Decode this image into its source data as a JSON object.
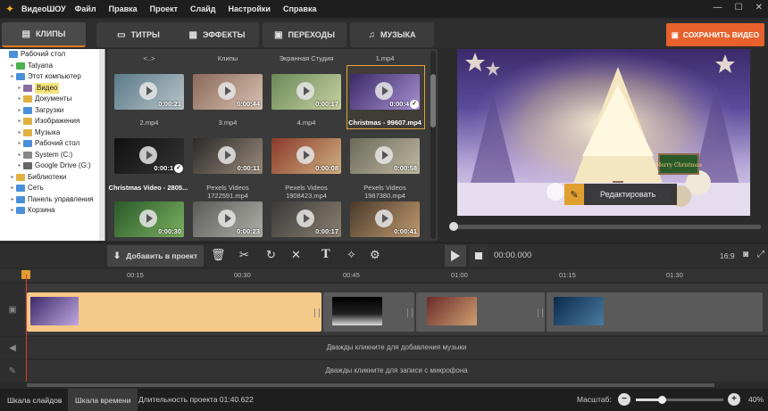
{
  "app": {
    "title": "ВидеоШОУ"
  },
  "menu": [
    "Файл",
    "Правка",
    "Проект",
    "Слайд",
    "Настройки",
    "Справка"
  ],
  "tabs": [
    {
      "label": "КЛИПЫ",
      "icon": "film-icon"
    },
    {
      "label": "ТИТРЫ",
      "icon": "text-icon"
    },
    {
      "label": "ЭФФЕКТЫ",
      "icon": "effects-icon"
    },
    {
      "label": "ПЕРЕХОДЫ",
      "icon": "transition-icon"
    },
    {
      "label": "МУЗЫКА",
      "icon": "music-icon"
    }
  ],
  "save_button": "СОХРАНИТЬ ВИДЕО",
  "tree": [
    {
      "label": "Рабочий стол",
      "indent": 0,
      "color": "#4a90d9"
    },
    {
      "label": "Tatyana",
      "indent": 1,
      "color": "#4caf50"
    },
    {
      "label": "Этот компьютер",
      "indent": 1,
      "color": "#4a90d9"
    },
    {
      "label": "Видео",
      "indent": 2,
      "color": "#8a6aa0",
      "selected": true
    },
    {
      "label": "Документы",
      "indent": 2,
      "color": "#e0b040"
    },
    {
      "label": "Загрузки",
      "indent": 2,
      "color": "#4a90d9"
    },
    {
      "label": "Изображения",
      "indent": 2,
      "color": "#e0b040"
    },
    {
      "label": "Музыка",
      "indent": 2,
      "color": "#e0b040"
    },
    {
      "label": "Рабочий стол",
      "indent": 2,
      "color": "#4a90d9"
    },
    {
      "label": "System (C:)",
      "indent": 2,
      "color": "#888888"
    },
    {
      "label": "Google Drive (G:)",
      "indent": 2,
      "color": "#666666"
    },
    {
      "label": "Библиотеки",
      "indent": 1,
      "color": "#e0b040"
    },
    {
      "label": "Сеть",
      "indent": 1,
      "color": "#4a90d9"
    },
    {
      "label": "Панель управления",
      "indent": 1,
      "color": "#4a90d9"
    },
    {
      "label": "Корзина",
      "indent": 1,
      "color": "#4a90d9"
    }
  ],
  "gallery": {
    "headers": [
      "<..>",
      "Клипы",
      "Экранная Студия",
      "1.mp4"
    ],
    "row2_headers": [
      "2.mp4",
      "3.mp4",
      "4.mp4",
      "Christmas - 99607.mp4"
    ],
    "row3_headers": [
      "Christmas Video - 2805...",
      "Pexels Videos 1722591.mp4",
      "Pexels Videos 1908423.mp4",
      "Pexels Videos 1987380.mp4"
    ],
    "durations": [
      [
        "0:00:21",
        "0:00:44",
        "0:00:17",
        "0:00:4"
      ],
      [
        "0:00:1",
        "0:00:11",
        "0:00:08",
        "0:00:58"
      ],
      [
        "0:00:30",
        "0:00:23",
        "0:00:17",
        "0:00:41"
      ]
    ]
  },
  "preview": {
    "edit_label": "Редактировать",
    "banner": "Merry Christmas"
  },
  "toolbar": {
    "add_label": "Добавить в проект",
    "timecode": "00:00.000",
    "ratio": "16:9"
  },
  "ruler": [
    "00:15",
    "00:30",
    "00:45",
    "01:00",
    "01:15",
    "01:30"
  ],
  "tracks": {
    "music_hint": "Дважды кликните для добавления музыки",
    "mic_hint": "Дважды кликните для записи с микрофона"
  },
  "bottom": {
    "slides_tab": "Шкала слайдов",
    "timeline_tab": "Шкала времени",
    "duration": "Длительность проекта 01:40.622",
    "zoom_label": "Масштаб:",
    "zoom_value": "40%",
    "zoom_level": 0.3
  }
}
